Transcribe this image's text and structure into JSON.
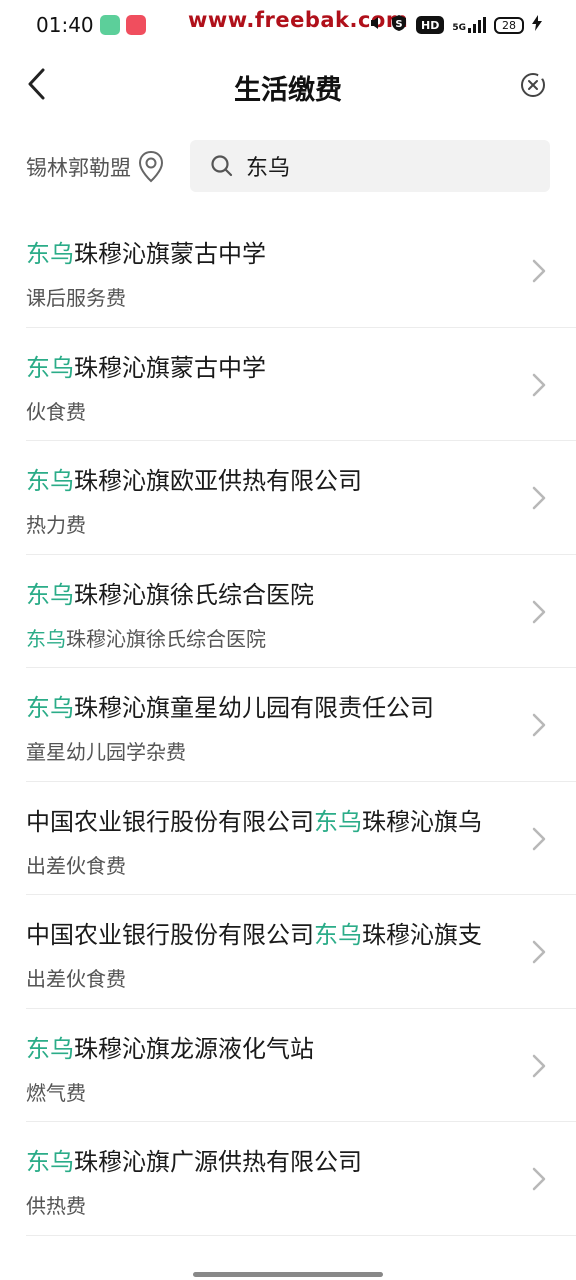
{
  "status_bar": {
    "time": "01:40",
    "watermark": "www.freebak.com",
    "network": "5G",
    "hd": "HD",
    "battery": "28"
  },
  "nav": {
    "title": "生活缴费"
  },
  "search": {
    "location": "锡林郭勒盟",
    "query": "东乌"
  },
  "colors": {
    "highlight": "#2bac88"
  },
  "results": [
    {
      "hl": "东乌",
      "title_rest": "珠穆沁旗蒙古中学",
      "sub_hl": "",
      "sub": "课后服务费"
    },
    {
      "hl": "东乌",
      "title_rest": "珠穆沁旗蒙古中学",
      "sub_hl": "",
      "sub": "伙食费"
    },
    {
      "hl": "东乌",
      "title_rest": "珠穆沁旗欧亚供热有限公司",
      "sub_hl": "",
      "sub": "热力费"
    },
    {
      "hl": "东乌",
      "title_rest": "珠穆沁旗徐氏综合医院",
      "sub_hl": "东乌",
      "sub": "珠穆沁旗徐氏综合医院"
    },
    {
      "hl": "东乌",
      "title_rest": "珠穆沁旗童星幼儿园有限责任公司",
      "sub_hl": "",
      "sub": "童星幼儿园学杂费"
    },
    {
      "pre": "中国农业银行股份有限公司",
      "hl": "东乌",
      "title_rest": "珠穆沁旗乌",
      "sub_hl": "",
      "sub": "出差伙食费"
    },
    {
      "pre": "中国农业银行股份有限公司",
      "hl": "东乌",
      "title_rest": "珠穆沁旗支",
      "sub_hl": "",
      "sub": "出差伙食费"
    },
    {
      "hl": "东乌",
      "title_rest": "珠穆沁旗龙源液化气站",
      "sub_hl": "",
      "sub": "燃气费"
    },
    {
      "hl": "东乌",
      "title_rest": "珠穆沁旗广源供热有限公司",
      "sub_hl": "",
      "sub": "供热费"
    }
  ]
}
